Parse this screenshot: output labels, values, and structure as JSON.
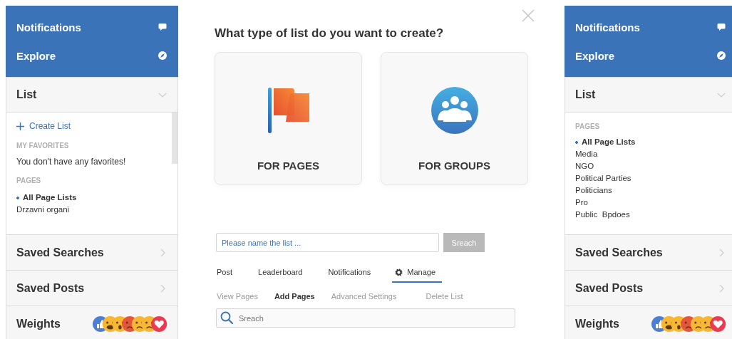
{
  "left_panel": {
    "nav": [
      {
        "label": "Notifications",
        "kind": "chat"
      },
      {
        "label": "Explore",
        "kind": "compass"
      }
    ],
    "list": {
      "title": "List",
      "expanded": true,
      "create_link": "Create List",
      "groups": [
        {
          "heading": "MY FAVORITES",
          "empty": "You don't have any favorites!"
        },
        {
          "heading": "PAGES",
          "items": [
            {
              "label": "All Page Lists",
              "selected": true
            },
            {
              "label": "Drzavni organi",
              "selected": false
            }
          ]
        }
      ]
    },
    "sections": [
      {
        "title": "Saved Searches",
        "kind": "link"
      },
      {
        "title": "Saved Posts",
        "kind": "link"
      },
      {
        "title": "Weights",
        "kind": "reactions"
      }
    ]
  },
  "modal": {
    "title": "What type of list do you want to create?",
    "cards": [
      {
        "label": "FOR PAGES",
        "kind": "flag"
      },
      {
        "label": "FOR GROUPS",
        "kind": "groups"
      }
    ],
    "name_field": {
      "placeholder": "Please name the list ..."
    },
    "name_button": {
      "label": "Sreach",
      "disabled": true
    },
    "tabs": [
      {
        "label": "Post",
        "selected": false
      },
      {
        "label": "Leaderboard",
        "selected": false
      },
      {
        "label": "Notifications",
        "selected": false
      },
      {
        "label": "Manage",
        "selected": true,
        "kind": "gear"
      }
    ],
    "subtabs": [
      {
        "label": "View Pages",
        "selected": false
      },
      {
        "label": "Add Pages",
        "selected": true
      },
      {
        "label": "Advanced Settings",
        "selected": false
      },
      {
        "label": "Delete List",
        "selected": false
      }
    ],
    "search_field": {
      "placeholder": "Sreach"
    }
  },
  "right_panel": {
    "nav": [
      {
        "label": "Notifications",
        "kind": "chat"
      },
      {
        "label": "Explore",
        "kind": "compass"
      }
    ],
    "list": {
      "title": "List",
      "expanded": true,
      "groups": [
        {
          "heading": "PAGES",
          "items": [
            {
              "label": "All Page Lists",
              "selected": true
            },
            {
              "label": "Media",
              "selected": false
            },
            {
              "label": "NGO",
              "selected": false
            },
            {
              "label": "Political Parties",
              "selected": false
            },
            {
              "label": "Politicians",
              "selected": false
            },
            {
              "label": "Pro",
              "selected": false
            },
            {
              "label": "Public  Bpdoes",
              "selected": false
            }
          ]
        }
      ]
    },
    "sections": [
      {
        "title": "Saved Searches",
        "kind": "link"
      },
      {
        "title": "Saved Posts",
        "kind": "link"
      },
      {
        "title": "Weights",
        "kind": "reactions"
      }
    ]
  }
}
